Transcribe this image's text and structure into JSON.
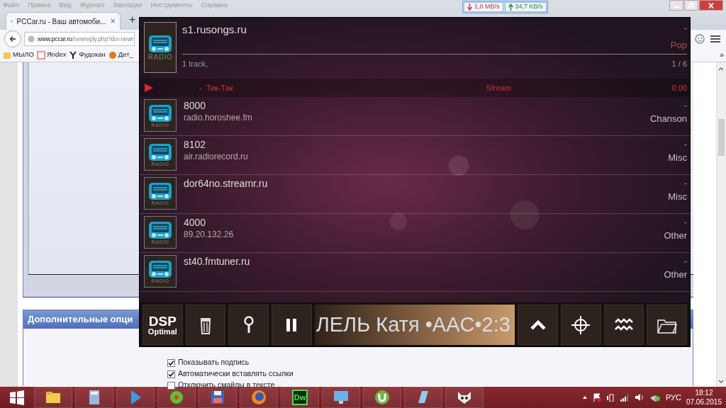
{
  "browser": {
    "menu": [
      "Файл",
      "Правка",
      "Вид",
      "Журнал",
      "Закладки",
      "Инструменты",
      "Справка"
    ],
    "tabs": [
      {
        "title": "PCCar.ru - Ваш автомоби...",
        "close": "×",
        "selected": true
      }
    ],
    "new_tab": "+",
    "address": {
      "host": "www.pccar.ru",
      "path": "/newreply.php?do=newr"
    },
    "bookmarks": [
      "МЫЛО",
      "Яndex",
      "Фудокан",
      "Дет_"
    ],
    "overflow": "»"
  },
  "net_meter": {
    "down": "1,0 MB/s",
    "up": "34,7 KB/s"
  },
  "page": {
    "panel_title": "Дополнительные опци",
    "options": [
      {
        "label": "Показывать подпись",
        "checked": true
      },
      {
        "label": "Автоматически вставлять ссылки",
        "checked": true
      },
      {
        "label": "Отключить смайлы в тексте",
        "checked": false
      }
    ]
  },
  "player": {
    "station": {
      "art_label": "RADIO",
      "name": "s1.rusongs.ru",
      "dash": "-",
      "genre": "Pop",
      "tracks": "1 track,",
      "position": "1 / 6"
    },
    "now_playing": {
      "dash": "-",
      "title": "Тик-Так",
      "source": "Stream",
      "time": "0:00"
    },
    "stations": [
      {
        "art_label": "RADIO",
        "name": "8000",
        "url": "radio.horoshee.fm",
        "dash": "-",
        "genre": "Chanson"
      },
      {
        "art_label": "RADIO",
        "name": "8102",
        "url": "air.radiorecord.ru",
        "dash": "-",
        "genre": "Misc"
      },
      {
        "art_label": "RADIO",
        "name": "dor64no.streamr.ru",
        "dash": "-",
        "genre": "Misc"
      },
      {
        "art_label": "RADIO",
        "name": "4000",
        "url": "89.20.132.26",
        "dash": "-",
        "genre": "Other"
      },
      {
        "art_label": "RADIO",
        "name": "st40.fmtuner.ru",
        "dash": "-",
        "genre": "Other"
      }
    ],
    "toolbar": {
      "dsp": "DSP",
      "dsp_mode": "Optimal",
      "marquee": "ЛЕЛЬ Катя •AAC•2:3"
    }
  },
  "taskbar": {
    "app_badge": "Dw",
    "language": "РУС",
    "time": "18:12",
    "date": "07.06.2015"
  }
}
